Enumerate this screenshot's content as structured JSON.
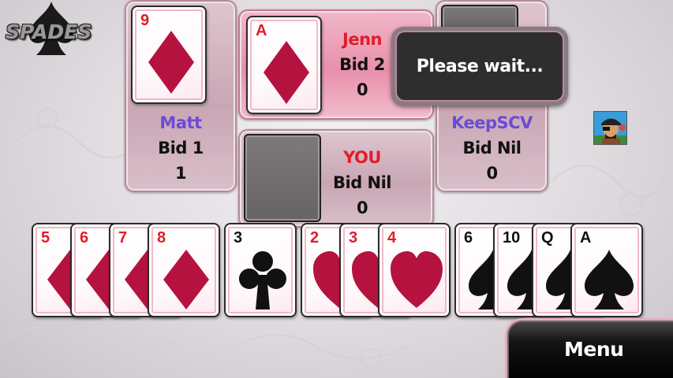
{
  "app": {
    "logo_text": "SPADES"
  },
  "players": {
    "west": {
      "name": "Matt",
      "name_color": "#6a4bd6",
      "bid": "Bid 1",
      "tricks": "1",
      "played_card": {
        "rank": "9",
        "suit": "diamonds"
      }
    },
    "north": {
      "name": "Jenn",
      "name_color": "#e01d2a",
      "bid": "Bid 2",
      "tricks": "0",
      "played_card": {
        "rank": "A",
        "suit": "diamonds"
      }
    },
    "east": {
      "name": "KeepSCV",
      "name_color": "#6a4bd6",
      "bid": "Bid Nil",
      "tricks": "0"
    },
    "south": {
      "name": "YOU",
      "name_color": "#e01d2a",
      "bid": "Bid Nil",
      "tricks": "0"
    }
  },
  "dialog": {
    "text": "Please wait..."
  },
  "hand": [
    {
      "rank": "5",
      "suit": "diamonds"
    },
    {
      "rank": "6",
      "suit": "diamonds"
    },
    {
      "rank": "7",
      "suit": "diamonds"
    },
    {
      "rank": "8",
      "suit": "diamonds"
    },
    {
      "rank": "3",
      "suit": "clubs"
    },
    {
      "rank": "2",
      "suit": "hearts"
    },
    {
      "rank": "3",
      "suit": "hearts"
    },
    {
      "rank": "4",
      "suit": "hearts"
    },
    {
      "rank": "6",
      "suit": "spades"
    },
    {
      "rank": "10",
      "suit": "spades"
    },
    {
      "rank": "Q",
      "suit": "spades"
    },
    {
      "rank": "A",
      "suit": "spades"
    }
  ],
  "menu": {
    "label": "Menu"
  },
  "colors": {
    "red_suit": "#e01d2a",
    "card_pip_red": "#b5123f",
    "black_suit": "#111111",
    "active_panel": "#f2b7c9"
  },
  "icons": {
    "avatar": "pirate-avatar-icon",
    "logo": "spade-logo-icon"
  }
}
